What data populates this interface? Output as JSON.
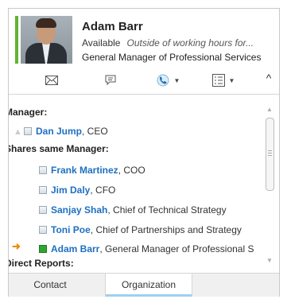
{
  "contact": {
    "name": "Adam Barr",
    "availability": "Available",
    "status_note": "Outside of working hours for...",
    "job_title": "General Manager of Professional Services",
    "presence_color": "#5fb531"
  },
  "toolbar": {
    "icons": [
      "email-icon",
      "instant-message-icon",
      "call-icon",
      "contact-card-icon"
    ],
    "collapse_glyph": "^"
  },
  "org": {
    "manager_label": "Manager:",
    "manager": {
      "name": "Dan Jump",
      "role": ", CEO"
    },
    "peers_label": "Shares same Manager:",
    "peers": [
      {
        "name": "Frank Martinez",
        "role": ", COO"
      },
      {
        "name": "Jim Daly",
        "role": ", CFO"
      },
      {
        "name": "Sanjay Shah",
        "role": ", Chief of Technical Strategy"
      },
      {
        "name": "Toni Poe",
        "role": ", Chief of Partnerships and Strategy"
      }
    ],
    "self": {
      "name": "Adam Barr",
      "role": ", General Manager of Professional S"
    },
    "reports_label": "Direct Reports:"
  },
  "tabs": {
    "contact": "Contact",
    "organization": "Organization",
    "active": "Organization"
  },
  "colors": {
    "link": "#1e70c1",
    "accent_tab": "#9fd0f0",
    "current_arrow": "#f08a12"
  }
}
